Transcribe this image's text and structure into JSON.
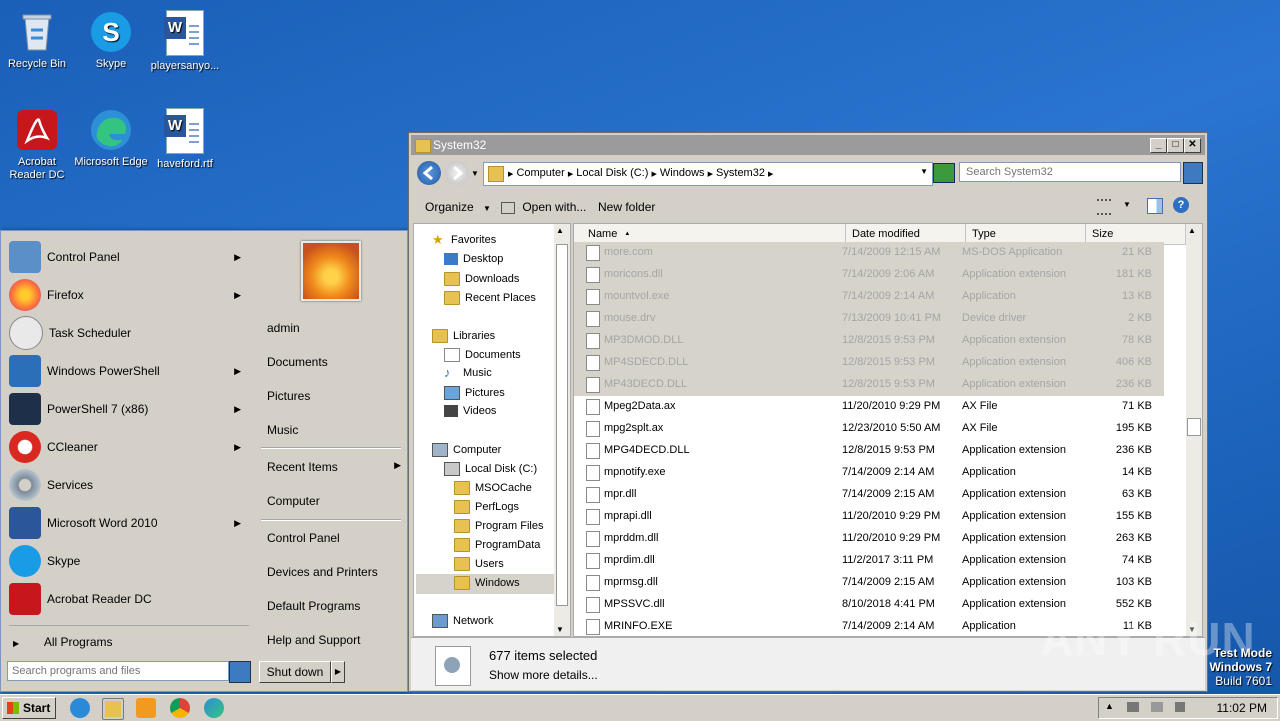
{
  "desktop": {
    "icons": [
      {
        "label": "Recycle Bin",
        "icon": "recycle-bin-icon"
      },
      {
        "label": "Skype",
        "icon": "skype-icon"
      },
      {
        "label": "playersanyo...",
        "icon": "word-document-icon"
      },
      {
        "label": "Acrobat Reader DC",
        "icon": "acrobat-icon"
      },
      {
        "label": "Microsoft Edge",
        "icon": "edge-icon"
      },
      {
        "label": "haveford.rtf",
        "icon": "word-document-icon"
      }
    ]
  },
  "start_menu": {
    "programs": [
      {
        "label": "Control Panel",
        "icon": "control-panel-icon",
        "submenu": "▶"
      },
      {
        "label": "Firefox",
        "icon": "firefox-icon",
        "submenu": "▶"
      },
      {
        "label": "Task Scheduler",
        "icon": "task-scheduler-icon",
        "submenu": ""
      },
      {
        "label": "Windows PowerShell",
        "icon": "powershell-icon",
        "submenu": "▶"
      },
      {
        "label": "PowerShell 7 (x86)",
        "icon": "powershell7-icon",
        "submenu": "▶"
      },
      {
        "label": "CCleaner",
        "icon": "ccleaner-icon",
        "submenu": "▶"
      },
      {
        "label": "Services",
        "icon": "services-icon",
        "submenu": ""
      },
      {
        "label": "Microsoft Word 2010",
        "icon": "word-icon",
        "submenu": "▶"
      },
      {
        "label": "Skype",
        "icon": "skype-icon",
        "submenu": ""
      },
      {
        "label": "Acrobat Reader DC",
        "icon": "acrobat-icon",
        "submenu": ""
      }
    ],
    "all_programs": "All Programs",
    "all_programs_arrow": "▶",
    "search_placeholder": "Search programs and files",
    "user_name": "admin",
    "right_items": [
      {
        "label": "Documents",
        "submenu": ""
      },
      {
        "label": "Pictures",
        "submenu": ""
      },
      {
        "label": "Music",
        "submenu": ""
      },
      {
        "label": "Recent Items",
        "submenu": "▶"
      },
      {
        "label": "Computer",
        "submenu": ""
      },
      {
        "label": "Control Panel",
        "submenu": ""
      },
      {
        "label": "Devices and Printers",
        "submenu": ""
      },
      {
        "label": "Default Programs",
        "submenu": ""
      },
      {
        "label": "Help and Support",
        "submenu": ""
      }
    ],
    "shutdown_label": "Shut down",
    "shutdown_arrow": "▶"
  },
  "explorer": {
    "title": "System32",
    "window_buttons": {
      "minimize": "_",
      "maximize": "□",
      "close": "✕"
    },
    "breadcrumb": [
      "Computer",
      "Local Disk (C:)",
      "Windows",
      "System32"
    ],
    "search_placeholder": "Search System32",
    "toolbar": {
      "organize": "Organize",
      "open_with": "Open with...",
      "new_folder": "New folder"
    },
    "nav_tree": [
      {
        "label": "Favorites",
        "icon": "favorites-star-icon",
        "level": 0
      },
      {
        "label": "Desktop",
        "icon": "desktop-icon",
        "level": 1
      },
      {
        "label": "Downloads",
        "icon": "downloads-icon",
        "level": 1
      },
      {
        "label": "Recent Places",
        "icon": "recent-places-icon",
        "level": 1
      },
      {
        "label": "Libraries",
        "icon": "libraries-icon",
        "level": 0
      },
      {
        "label": "Documents",
        "icon": "documents-icon",
        "level": 1
      },
      {
        "label": "Music",
        "icon": "music-icon",
        "level": 1
      },
      {
        "label": "Pictures",
        "icon": "pictures-icon",
        "level": 1
      },
      {
        "label": "Videos",
        "icon": "videos-icon",
        "level": 1
      },
      {
        "label": "Computer",
        "icon": "computer-icon",
        "level": 0
      },
      {
        "label": "Local Disk (C:)",
        "icon": "disk-icon",
        "level": 1
      },
      {
        "label": "MSOCache",
        "icon": "folder-locked-icon",
        "level": 2
      },
      {
        "label": "PerfLogs",
        "icon": "folder-icon",
        "level": 2
      },
      {
        "label": "Program Files",
        "icon": "folder-icon",
        "level": 2
      },
      {
        "label": "ProgramData",
        "icon": "folder-icon",
        "level": 2
      },
      {
        "label": "Users",
        "icon": "folder-icon",
        "level": 2
      },
      {
        "label": "Windows",
        "icon": "folder-icon",
        "level": 2,
        "selected": true
      },
      {
        "label": "Network",
        "icon": "network-icon",
        "level": 0
      }
    ],
    "columns": [
      "Name",
      "Date modified",
      "Type",
      "Size"
    ],
    "sort_indicator": "▲",
    "files": [
      {
        "name": "more.com",
        "date": "7/14/2009 12:15 AM",
        "type": "MS-DOS Application",
        "size": "21 KB",
        "selected": true
      },
      {
        "name": "moricons.dll",
        "date": "7/14/2009 2:06 AM",
        "type": "Application extension",
        "size": "181 KB",
        "selected": true
      },
      {
        "name": "mountvol.exe",
        "date": "7/14/2009 2:14 AM",
        "type": "Application",
        "size": "13 KB",
        "selected": true
      },
      {
        "name": "mouse.drv",
        "date": "7/13/2009 10:41 PM",
        "type": "Device driver",
        "size": "2 KB",
        "selected": true
      },
      {
        "name": "MP3DMOD.DLL",
        "date": "12/8/2015 9:53 PM",
        "type": "Application extension",
        "size": "78 KB",
        "selected": true
      },
      {
        "name": "MP4SDECD.DLL",
        "date": "12/8/2015 9:53 PM",
        "type": "Application extension",
        "size": "406 KB",
        "selected": true
      },
      {
        "name": "MP43DECD.DLL",
        "date": "12/8/2015 9:53 PM",
        "type": "Application extension",
        "size": "236 KB",
        "selected": true
      },
      {
        "name": "Mpeg2Data.ax",
        "date": "11/20/2010 9:29 PM",
        "type": "AX File",
        "size": "71 KB",
        "selected": false
      },
      {
        "name": "mpg2splt.ax",
        "date": "12/23/2010 5:50 AM",
        "type": "AX File",
        "size": "195 KB",
        "selected": false
      },
      {
        "name": "MPG4DECD.DLL",
        "date": "12/8/2015 9:53 PM",
        "type": "Application extension",
        "size": "236 KB",
        "selected": false
      },
      {
        "name": "mpnotify.exe",
        "date": "7/14/2009 2:14 AM",
        "type": "Application",
        "size": "14 KB",
        "selected": false
      },
      {
        "name": "mpr.dll",
        "date": "7/14/2009 2:15 AM",
        "type": "Application extension",
        "size": "63 KB",
        "selected": false
      },
      {
        "name": "mprapi.dll",
        "date": "11/20/2010 9:29 PM",
        "type": "Application extension",
        "size": "155 KB",
        "selected": false
      },
      {
        "name": "mprddm.dll",
        "date": "11/20/2010 9:29 PM",
        "type": "Application extension",
        "size": "263 KB",
        "selected": false
      },
      {
        "name": "mprdim.dll",
        "date": "11/2/2017 3:11 PM",
        "type": "Application extension",
        "size": "74 KB",
        "selected": false
      },
      {
        "name": "mprmsg.dll",
        "date": "7/14/2009 2:15 AM",
        "type": "Application extension",
        "size": "103 KB",
        "selected": false
      },
      {
        "name": "MPSSVC.dll",
        "date": "8/10/2018 4:41 PM",
        "type": "Application extension",
        "size": "552 KB",
        "selected": false
      },
      {
        "name": "MRINFO.EXE",
        "date": "7/14/2009 2:14 AM",
        "type": "Application",
        "size": "11 KB",
        "selected": false
      }
    ],
    "status": {
      "count": "677 items selected",
      "more": "Show more details..."
    }
  },
  "taskbar": {
    "start_label": "Start",
    "pinned": [
      "internet-explorer-icon",
      "file-explorer-icon",
      "media-player-icon",
      "chrome-icon",
      "edge-icon"
    ],
    "tray_chevron": "▲",
    "time": "11:02 PM"
  },
  "watermark": {
    "line1": "Test Mode",
    "line2": "Windows 7",
    "line3": "Build 7601",
    "anyrun": "ANY RUN"
  },
  "colors": {
    "desktop": "#1f66c0",
    "selection": "#d6d3cb",
    "chrome": "#d4d0c8"
  }
}
